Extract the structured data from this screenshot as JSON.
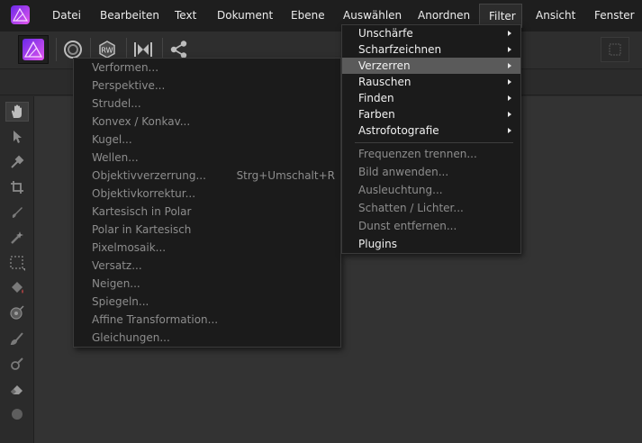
{
  "menubar": {
    "items": [
      {
        "label": "Datei"
      },
      {
        "label": "Bearbeiten"
      },
      {
        "label": "Text"
      },
      {
        "label": "Dokument"
      },
      {
        "label": "Ebene"
      },
      {
        "label": "Auswählen"
      },
      {
        "label": "Anordnen"
      },
      {
        "label": "Filter"
      },
      {
        "label": "Ansicht"
      },
      {
        "label": "Fenster"
      }
    ],
    "active": "Filter"
  },
  "filter_menu": {
    "submenus": [
      {
        "label": "Unschärfe"
      },
      {
        "label": "Scharfzeichnen"
      },
      {
        "label": "Verzerren"
      },
      {
        "label": "Rauschen"
      },
      {
        "label": "Finden"
      },
      {
        "label": "Farben"
      },
      {
        "label": "Astrofotografie"
      }
    ],
    "items": [
      {
        "label": "Frequenzen trennen..."
      },
      {
        "label": "Bild anwenden..."
      },
      {
        "label": "Ausleuchtung..."
      },
      {
        "label": "Schatten / Lichter..."
      },
      {
        "label": "Dunst entfernen..."
      },
      {
        "label": "Plugins"
      }
    ],
    "highlighted": "Verzerren"
  },
  "verzerren_menu": {
    "items": [
      {
        "label": "Verformen..."
      },
      {
        "label": "Perspektive..."
      },
      {
        "label": "Strudel..."
      },
      {
        "label": "Konvex / Konkav..."
      },
      {
        "label": "Kugel..."
      },
      {
        "label": "Wellen..."
      },
      {
        "label": "Objektivverzerrung...",
        "shortcut": "Strg+Umschalt+R"
      },
      {
        "label": "Objektivkorrektur..."
      },
      {
        "label": "Kartesisch in Polar"
      },
      {
        "label": "Polar in Kartesisch"
      },
      {
        "label": "Pixelmosaik..."
      },
      {
        "label": "Versatz..."
      },
      {
        "label": "Neigen..."
      },
      {
        "label": "Spiegeln..."
      },
      {
        "label": "Affine Transformation..."
      },
      {
        "label": "Gleichungen..."
      }
    ]
  },
  "icons": {
    "app_logo": "affinity-photo-logo-icon",
    "toolbar": [
      "photo-persona-icon",
      "liquify-persona-icon",
      "develop-persona-icon",
      "tone-mapping-persona-icon",
      "export-persona-icon"
    ],
    "tools": [
      "view-tool-icon",
      "move-tool-icon",
      "color-picker-icon",
      "crop-tool-icon",
      "selection-brush-icon",
      "flood-select-icon",
      "marquee-tool-icon",
      "flood-fill-icon",
      "gradient-tool-icon",
      "paint-brush-icon",
      "dodge-brush-icon",
      "erase-brush-icon",
      "blur-brush-icon"
    ]
  },
  "colors": {
    "brand_gradient_start": "#7d2cf5",
    "brand_gradient_end": "#e84cf0",
    "menu_highlight": "#5a5a5a",
    "menu_bg": "#1b1b1b"
  }
}
